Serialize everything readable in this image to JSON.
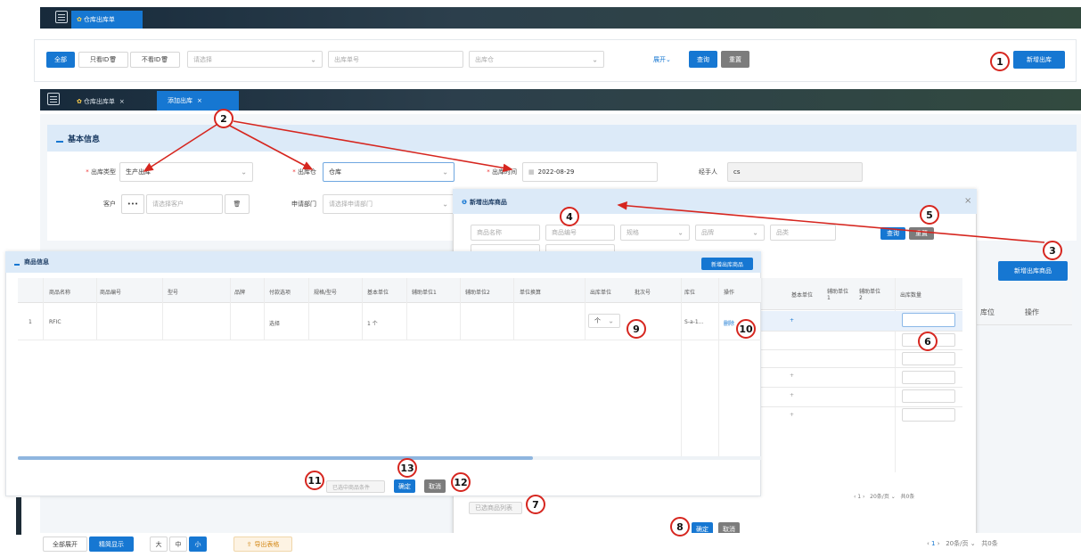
{
  "top_bar": {
    "tab_label": "仓库出库单"
  },
  "filter": {
    "all": "全部",
    "only_mine": "只看ID🗑",
    "exclude_mine": "不看ID🗑",
    "select_placeholder": "请选择",
    "order_placeholder": "出库单号",
    "warehouse_placeholder": "出库仓",
    "expand": "展开",
    "search": "查询",
    "reset": "重置",
    "new_outbound": "新增出库"
  },
  "tabs2": {
    "tab1": "仓库出库单",
    "tab2": "添加出库"
  },
  "basic": {
    "title": "基本信息",
    "type_label": "出库类型",
    "type_value": "生产出库",
    "wh_label": "出库仓",
    "wh_value": "仓库",
    "time_label": "出库时间",
    "time_value": "2022-08-29",
    "handler_label": "经手人",
    "handler_value": "cs",
    "customer_label": "客户",
    "customer_btn": "•••",
    "customer_placeholder": "请选择客户",
    "dept_label": "申请部门",
    "dept_placeholder": "请选择申请部门"
  },
  "modal": {
    "title": "新增出库商品",
    "f1": "商品名称",
    "f2": "商品编号",
    "f3": "规格",
    "f4": "品牌",
    "f5": "品类",
    "search": "查询",
    "reset": "重置",
    "cols": [
      "基本单位",
      "辅助单位1",
      "辅助单位2",
      "出库数量"
    ],
    "pager": "20条/页",
    "pager_total": "共0条",
    "selected": "已选商品列表",
    "confirm": "确定",
    "cancel": "取消"
  },
  "goods": {
    "title": "商品信息",
    "add": "新增出库商品",
    "cols": [
      "商品名称",
      "商品编号",
      "型号",
      "品牌",
      "付款选项",
      "规格/型号",
      "基本单位",
      "辅助单位1",
      "辅助单位2",
      "单位换算",
      "出库单位",
      "批次号",
      "库位",
      "操作"
    ],
    "row": {
      "idx": "1",
      "name": "RFIC",
      "opt": "选择",
      "unit": "1 个",
      "out_unit": "个",
      "loc": "S-a-1...",
      "op": "删除"
    },
    "selected": "已选中商品条件",
    "confirm": "确定",
    "cancel": "取消"
  },
  "right_panel": {
    "add": "新增出库商品",
    "col_loc": "库位",
    "col_op": "操作"
  },
  "bottom": {
    "expand_all": "全部展开",
    "compact": "精简显示",
    "size_l": "大",
    "size_m": "中",
    "size_s": "小",
    "export": "导出表格",
    "pager": "20条/页",
    "total": "共0条"
  },
  "badges": [
    "1",
    "2",
    "3",
    "4",
    "5",
    "6",
    "7",
    "8",
    "9",
    "10",
    "11",
    "12",
    "13"
  ],
  "colors": {
    "primary": "#1677d2",
    "annotation": "#d6261f",
    "header_bg": "#dceaf8"
  },
  "icons": {
    "menu": "menu-icon",
    "home": "star-icon",
    "calendar": "calendar-icon",
    "delete": "trash-icon",
    "chart": "chart-icon"
  }
}
